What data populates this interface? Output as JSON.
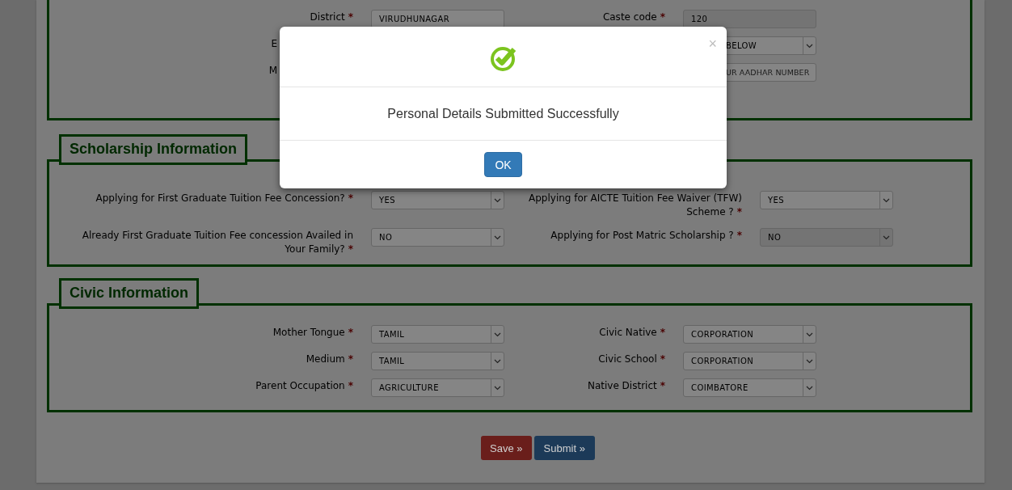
{
  "sections": [
    {
      "kind": "standard",
      "rows": [
        {
          "left": {
            "label": "District",
            "required": "*",
            "field": {
              "kind": "text",
              "value": "VIRUDHUNAGAR",
              "disabled": false,
              "covered": false
            }
          },
          "right": {
            "label": "Caste code",
            "required": "*",
            "field": {
              "kind": "text",
              "value": "120",
              "disabled": true,
              "covered": false
            }
          }
        },
        {
          "left": {
            "label": "E"
          },
          "right": {
            "field": {
              "kind": "select",
              "value": "BELOW",
              "disabled": false,
              "covered": true
            }
          }
        },
        {
          "left": {
            "label": "M"
          },
          "right": {
            "field": {
              "kind": "text",
              "placeholder": "UR AADHAR NUMBER",
              "disabled": false,
              "covered": true
            }
          }
        }
      ]
    },
    {
      "legend": "Scholarship Information",
      "kind": "wide",
      "rows": [
        {
          "left": {
            "label": "Applying for First Graduate Tuition Fee Concession?",
            "required": "*",
            "field": {
              "kind": "select",
              "value": "YES",
              "disabled": false,
              "covered": false
            }
          },
          "right": {
            "label": "Applying for AICTE Tuition Fee Waiver (TFW) Scheme ?",
            "required": "*",
            "field": {
              "kind": "select",
              "value": "YES",
              "disabled": false,
              "covered": false
            }
          }
        },
        {
          "left": {
            "label": "Already First Graduate Tuition Fee concession Availed in Your Family?",
            "required": "*",
            "field": {
              "kind": "select",
              "value": "NO",
              "disabled": false,
              "covered": false
            }
          },
          "right": {
            "label": "Applying for Post Matric Scholarship ?",
            "required": "*",
            "field": {
              "kind": "select",
              "value": "NO",
              "disabled": true,
              "covered": false
            }
          }
        }
      ]
    },
    {
      "legend": "Civic Information",
      "kind": "standard",
      "rows": [
        {
          "left": {
            "label": "Mother Tongue",
            "required": "*",
            "field": {
              "kind": "select",
              "value": "TAMIL",
              "disabled": false,
              "covered": false
            }
          },
          "right": {
            "label": "Civic Native",
            "required": "*",
            "field": {
              "kind": "select",
              "value": "CORPORATION",
              "disabled": false,
              "covered": false
            }
          }
        },
        {
          "left": {
            "label": "Medium",
            "required": "*",
            "field": {
              "kind": "select",
              "value": "TAMIL",
              "disabled": false,
              "covered": false
            }
          },
          "right": {
            "label": "Civic School",
            "required": "*",
            "field": {
              "kind": "select",
              "value": "CORPORATION",
              "disabled": false,
              "covered": false
            }
          }
        },
        {
          "left": {
            "label": "Parent Occupation",
            "required": "*",
            "field": {
              "kind": "select",
              "value": "AGRICULTURE",
              "disabled": false,
              "covered": false
            }
          },
          "right": {
            "label": "Native District",
            "required": "*",
            "field": {
              "kind": "select",
              "value": "COIMBATORE",
              "disabled": false,
              "covered": false
            }
          }
        }
      ]
    }
  ],
  "buttons": [
    {
      "label": "Save »",
      "kind": "danger"
    },
    {
      "label": "Submit »",
      "kind": "primary"
    }
  ],
  "modal": {
    "close": "×",
    "message": "Personal Details Submitted Successfully",
    "ok": "OK"
  }
}
